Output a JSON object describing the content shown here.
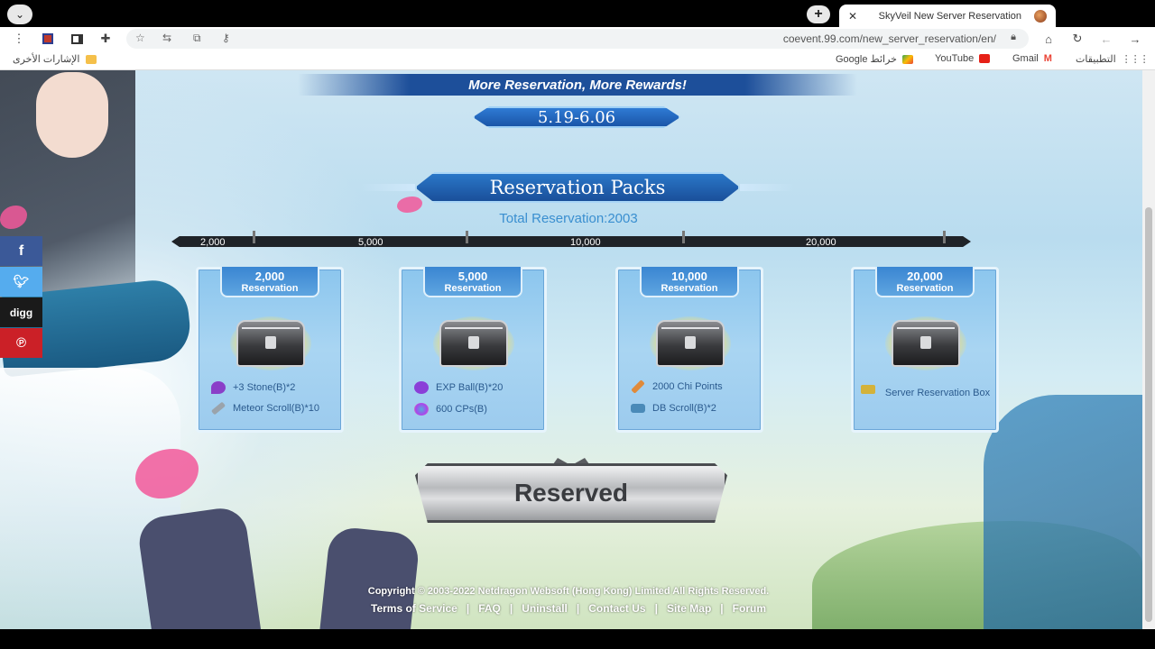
{
  "browser": {
    "tab_title": "SkyVeil New Server Reservation",
    "url": "coevent.99.com/new_server_reservation/en/",
    "bookmarks": {
      "apps": "التطبيقات",
      "gmail": "Gmail",
      "youtube": "YouTube",
      "maps": "Google خرائط",
      "other": "الإشارات الأخرى"
    }
  },
  "page": {
    "banner": "More Reservation, More Rewards!",
    "dates": "5.19-6.06",
    "packs_title": "Reservation Packs",
    "total_reservation": "Total Reservation:2003",
    "track_labels": [
      "2,000",
      "5,000",
      "10,000",
      "20,000"
    ],
    "cards": [
      {
        "number": "2,000",
        "label": "Reservation",
        "items": [
          "+3 Stone(B)*2",
          "Meteor Scroll(B)*10"
        ]
      },
      {
        "number": "5,000",
        "label": "Reservation",
        "items": [
          "EXP Ball(B)*20",
          "600 CPs(B)"
        ]
      },
      {
        "number": "10,000",
        "label": "Reservation",
        "items": [
          "2000 Chi Points",
          "DB Scroll(B)*2"
        ]
      },
      {
        "number": "20,000",
        "label": "Reservation",
        "items": [
          "Server Reservation Box"
        ]
      }
    ],
    "reserved_button": "Reserved",
    "social": {
      "facebook": "f",
      "twitter": "t",
      "digg": "digg",
      "pinterest": "P"
    },
    "copyright": "Copyright © 2003-2022 Netdragon Websoft (Hong Kong) Limited All Rights Reserved.",
    "footer_links": [
      "Terms of Service",
      "FAQ",
      "Uninstall",
      "Contact Us",
      "Site Map",
      "Forum"
    ]
  },
  "colors": {
    "banner": "#1d4f9a",
    "accent": "#2a77c8",
    "total_text": "#3a8fd0",
    "card_bg": "#a9d5f2"
  }
}
